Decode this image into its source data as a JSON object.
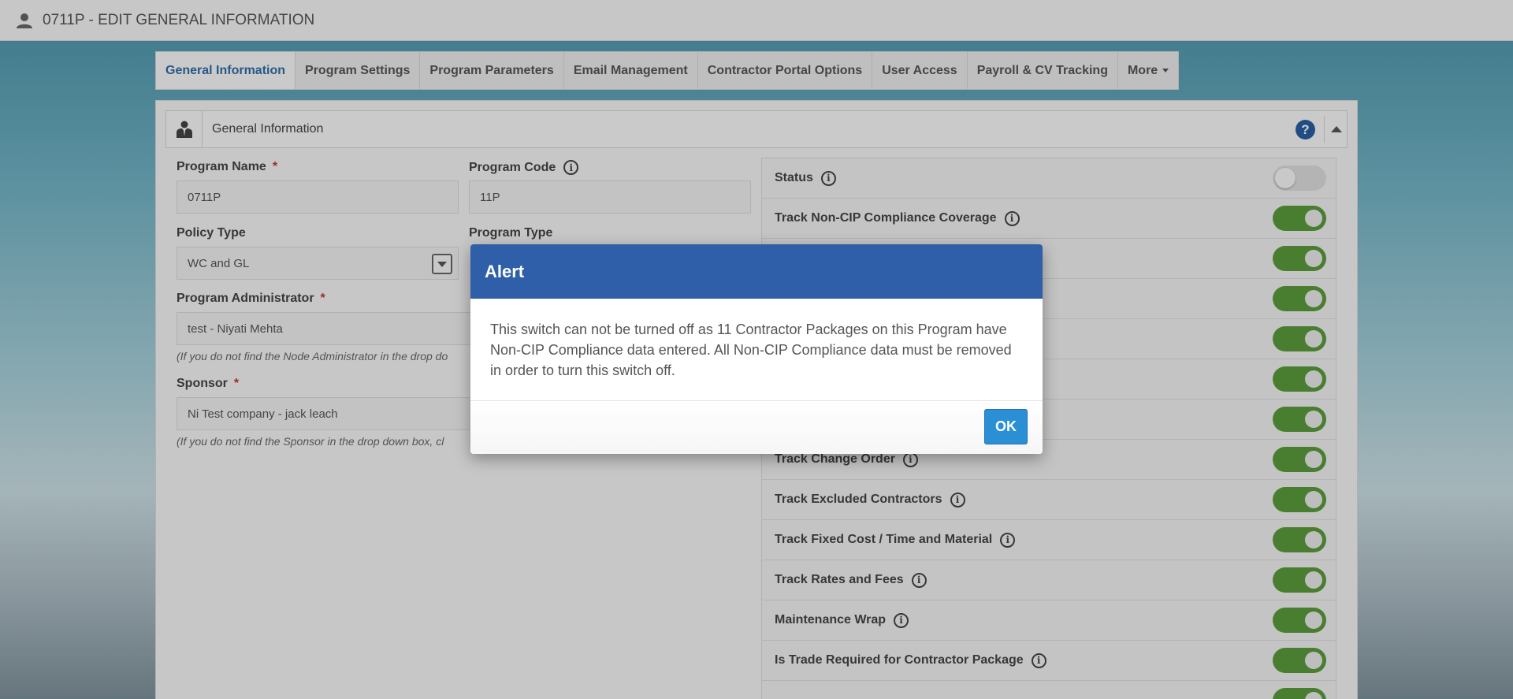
{
  "header": {
    "title": "0711P - EDIT GENERAL INFORMATION",
    "icon": "user-icon"
  },
  "tabs": [
    {
      "label": "General Information",
      "active": true
    },
    {
      "label": "Program Settings"
    },
    {
      "label": "Program Parameters"
    },
    {
      "label": "Email Management"
    },
    {
      "label": "Contractor Portal Options"
    },
    {
      "label": "User Access"
    },
    {
      "label": "Payroll & CV Tracking"
    },
    {
      "label": "More"
    }
  ],
  "panel": {
    "title": "General Information",
    "help_glyph": "?"
  },
  "form": {
    "program_name": {
      "label": "Program Name",
      "value": "0711P",
      "required": "*"
    },
    "program_code": {
      "label": "Program Code",
      "value": "11P"
    },
    "policy_type": {
      "label": "Policy Type",
      "value": "WC and GL"
    },
    "program_type": {
      "label": "Program Type"
    },
    "program_admin": {
      "label": "Program Administrator",
      "required": "*",
      "value": "test - Niyati Mehta",
      "hint": "(If you do not find the Node Administrator in the drop do"
    },
    "sponsor": {
      "label": "Sponsor",
      "required": "*",
      "value": "Ni Test company - jack leach",
      "hint": "(If you do not find the Sponsor in the drop down box,  cl"
    }
  },
  "toggles": [
    {
      "label": "Status",
      "on": false
    },
    {
      "label": "Track Non-CIP Compliance Coverage",
      "on": true
    },
    {
      "label": "",
      "on": true
    },
    {
      "label": "",
      "on": true
    },
    {
      "label": "",
      "on": true
    },
    {
      "label": "",
      "on": true
    },
    {
      "label": "",
      "on": true
    },
    {
      "label": "Track Change Order",
      "on": true
    },
    {
      "label": "Track Excluded Contractors",
      "on": true
    },
    {
      "label": "Track Fixed Cost / Time and Material",
      "on": true
    },
    {
      "label": "Track Rates and Fees",
      "on": true
    },
    {
      "label": "Maintenance Wrap",
      "on": true
    },
    {
      "label": "Is Trade Required for Contractor Package",
      "on": true
    },
    {
      "label": "",
      "on": true
    }
  ],
  "modal": {
    "title": "Alert",
    "message": "This switch can not be turned off as 11 Contractor Packages on this Program have Non-CIP Compliance data entered. All Non-CIP Compliance data must be removed in order to turn this switch off.",
    "ok_label": "OK"
  },
  "colors": {
    "accent": "#2e5fa8",
    "toggle_on": "#5a9a3c",
    "ok_button": "#2b8fd6"
  }
}
